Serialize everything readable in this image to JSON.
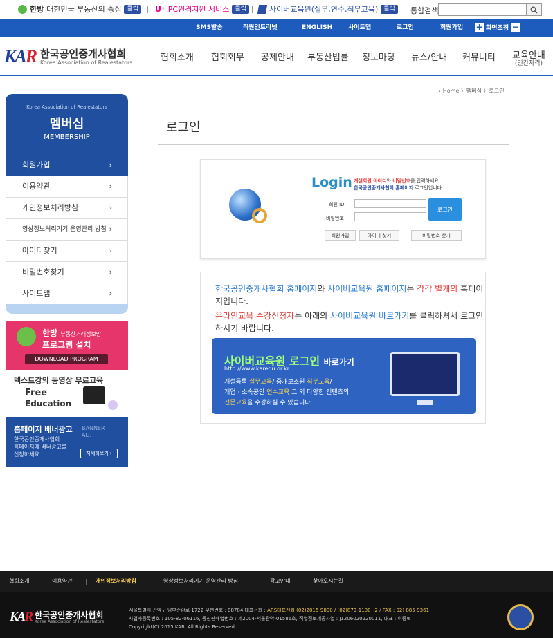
{
  "topbar": {
    "hanbang_logo": "한방",
    "hanbang_text": "대한민국 부동산의 중심",
    "click": "클릭",
    "uplus_logo": "U⁺",
    "pc_text": "PC원격지원 서비스",
    "cyber_text": "사이버교육원(실무,연수,직무교육)",
    "search_label": "통합검색",
    "search_value": ""
  },
  "util": {
    "items": [
      "SMS발송",
      "직원인트라넷",
      "ENGLISH",
      "사이트맵",
      "로그인",
      "회원가입"
    ],
    "zoom_label": "화면조정",
    "zoom_plus": "+",
    "zoom_minus": "−"
  },
  "header": {
    "logo_mark_a": "KA",
    "logo_mark_b": "R",
    "logo_ko": "한국공인중개사협회",
    "logo_en": "Korea Association of Realestators",
    "menu": [
      "협회소개",
      "협회회무",
      "공제안내",
      "부동산법률",
      "정보마당",
      "뉴스/안내",
      "커뮤니티",
      "교육안내"
    ],
    "menu_sub": "(민간자격)"
  },
  "breadcrumb": "› Home 〉멤버십 〉로그인",
  "sidebar": {
    "head_sub": "Korea Association of Realestators",
    "head_title": "멤버십",
    "head_en": "MEMBERSHIP",
    "items": [
      {
        "label": "회원가입"
      },
      {
        "label": "이용약관"
      },
      {
        "label": "개인정보처리방침"
      },
      {
        "label": "영상정보처리기기 운영관리 방침"
      },
      {
        "label": "아이디찾기"
      },
      {
        "label": "비밀번호찾기"
      },
      {
        "label": "사이트맵"
      }
    ],
    "chevron": "›"
  },
  "banners": {
    "b1_title": "한방",
    "b1_sub": "부동산거래정보망",
    "b1_title2": "프로그램 설치",
    "b1_btn": "DOWNLOAD PROGRAM",
    "b2_title": "텍스트강의 동영상 무료교육",
    "b2_free": "Free",
    "b2_edu": "Education",
    "b3_title": "홈페이지 배너광고",
    "b3_desc1": "한국공인중개사협회",
    "b3_desc2": "홈페이지에 배너광고를",
    "b3_desc3": "신청하세요",
    "b3_ad": "BANNER AD.",
    "b3_btn": "자세히보기 ›"
  },
  "page_title": "로그인",
  "login": {
    "title": "Login",
    "desc1_a": "개설회원 아이디",
    "desc1_b": "와 ",
    "desc1_c": "비밀번호",
    "desc1_d": "를 입력하세요.",
    "desc2_a": "한국공인중개사협회 홈페이지",
    "desc2_b": " 로그인입니다.",
    "id_label": "회원 ID",
    "pw_label": "비밀번호",
    "id_value": "",
    "pw_value": "",
    "login_button": "로그인",
    "join_button": "회원가입",
    "find_id_button": "아이디 찾기",
    "find_pw_button": "비밀번호 찾기"
  },
  "info": {
    "p1_a": "한국공인중개사협회 홈페이지",
    "p1_b": "와 ",
    "p1_c": "사이버교육원 홈페이지",
    "p1_d": "는 ",
    "p1_e": "각각 별개의",
    "p1_f": " 홈페이지입니다.",
    "p2_a": "온라인교육 수강신청자",
    "p2_b": "는 아래의 ",
    "p2_c": "사이버교육원 바로가기",
    "p2_d": "를 클릭하셔서 로그인하시기 바랍니다.",
    "cyber_title": "사이버교육원 로그인",
    "cyber_go": "바로가기",
    "cyber_url": "http://www.karedu.or.kr",
    "cyber_d1_a": "개설등록 ",
    "cyber_d1_b": "실무교육",
    "cyber_d1_c": "/ 중개보조원 ",
    "cyber_d1_d": "직무교육",
    "cyber_d1_e": "/",
    "cyber_d2_a": "개업 · 소속공인 ",
    "cyber_d2_b": "연수교육",
    "cyber_d2_c": " 그 외 다양한 컨텐츠의",
    "cyber_d3_a": "전문교육",
    "cyber_d3_b": "을 수강하실 수 있습니다."
  },
  "footer": {
    "nav": [
      "협회소개",
      "이용약관",
      "개인정보처리방침",
      "영상정보처리기기 운영관리 방침",
      "광고안내",
      "찾아오시는길"
    ],
    "logo_mark_a": "KA",
    "logo_mark_b": "R",
    "logo_ko": "한국공인중개사협회",
    "logo_en": "Korea Association of Realestators",
    "addr1_a": "서울특별시 관악구 남부순환로 1722 우편번호 : 08784 대표전화 : ",
    "addr1_b": "ARS대표전화 (02)2015-9800 / (02)879-1100~2 / FAX : 02) 885-9361",
    "addr2": "사업자등록번호 : 105-82-06116, 통신판매업번호 : 제2004-서울관악-01586호, 직업정보제공사업 : J1206020220011, 대표 : 이종혁",
    "copyright": "Copyright(C) 2015 KAR. All Rights Reserved."
  }
}
